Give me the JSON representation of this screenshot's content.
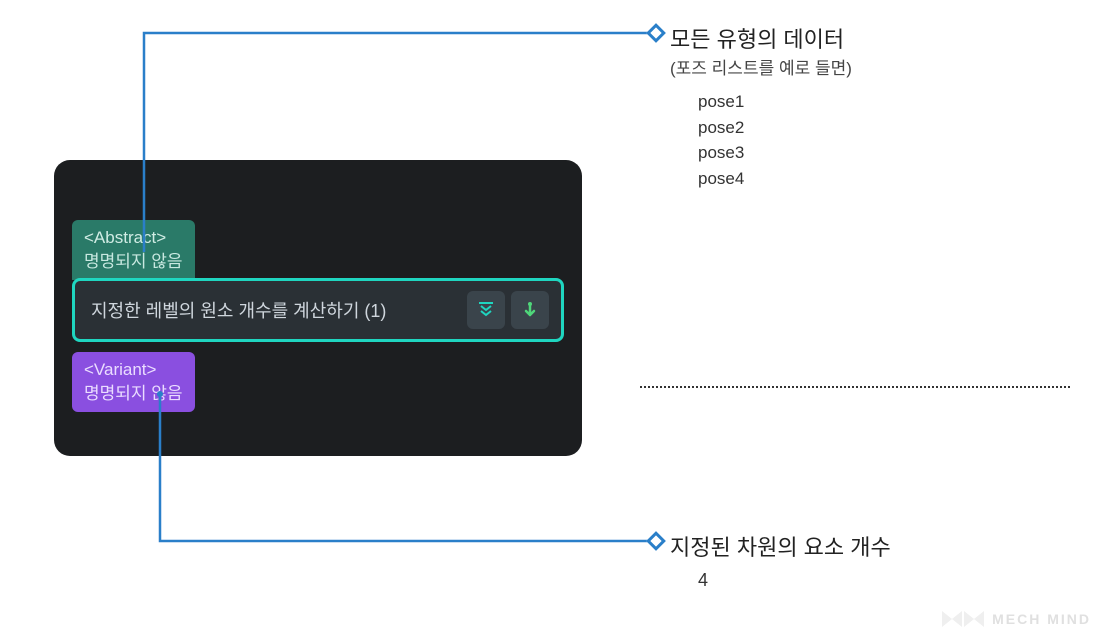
{
  "panel": {
    "abstract": {
      "type_label": "<Abstract>",
      "name": "명명되지 않음"
    },
    "selected_row": {
      "text": "지정한 레벨의 원소 개수를 계산하기 (1)"
    },
    "variant": {
      "type_label": "<Variant>",
      "name": "명명되지 않음"
    }
  },
  "callout_top": {
    "title": "모든 유형의 데이터",
    "subtitle": "(포즈 리스트를 예로 들면)",
    "items": [
      "pose1",
      "pose2",
      "pose3",
      "pose4"
    ]
  },
  "callout_bottom": {
    "title": "지정된 차원의 요소 개수",
    "value": "4"
  },
  "watermark": "MECH MIND"
}
